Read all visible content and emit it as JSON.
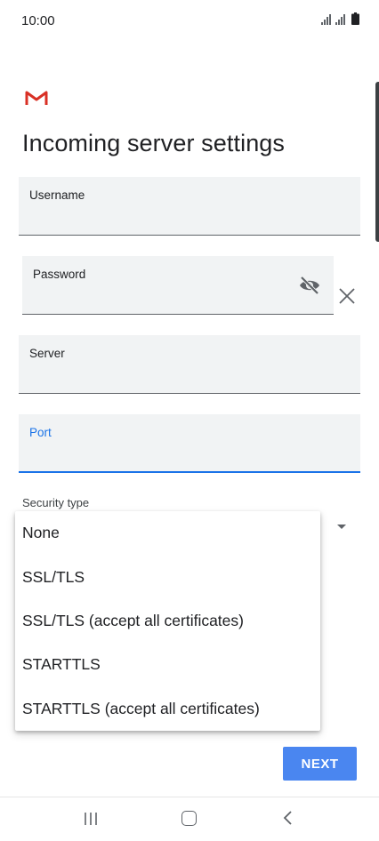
{
  "status_bar": {
    "time": "10:00"
  },
  "page": {
    "title": "Incoming server settings"
  },
  "fields": {
    "username": {
      "label": "Username",
      "value": ""
    },
    "password": {
      "label": "Password",
      "value": ""
    },
    "server": {
      "label": "Server",
      "value": ""
    },
    "port": {
      "label": "Port",
      "value": ""
    }
  },
  "security_type": {
    "label": "Security type",
    "options": [
      "None",
      "SSL/TLS",
      "SSL/TLS (accept all certificates)",
      "STARTTLS",
      "STARTTLS (accept all certificates)"
    ]
  },
  "actions": {
    "next_label": "NEXT"
  },
  "colors": {
    "accent": "#1a73e8",
    "button": "#4a86f0",
    "field_bg": "#f1f3f4",
    "gmail_red": "#d93025"
  },
  "icons": [
    "gmail-logo",
    "signal-icon",
    "battery-icon",
    "visibility-off-icon",
    "close-icon",
    "recent-apps-icon",
    "home-icon",
    "back-icon"
  ]
}
